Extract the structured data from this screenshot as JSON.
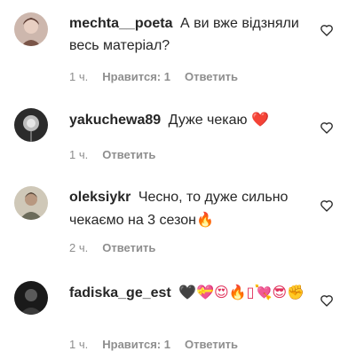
{
  "comments": [
    {
      "username": "mechta__poeta",
      "text": "А ви вже відзняли весь матеріал?",
      "time": "1 ч.",
      "likes": "Нравится: 1",
      "reply": "Ответить",
      "avatar_icon": "woman-portrait-avatar"
    },
    {
      "username": "yakuchewa89",
      "text": "Дуже чекаю",
      "emoji": "❤️",
      "time": "1 ч.",
      "reply": "Ответить",
      "avatar_icon": "dandelion-avatar"
    },
    {
      "username": "oleksiykr",
      "text": "Чесно, то дуже сильно чекаємо на 3 сезон",
      "emoji": "🔥",
      "time": "2 ч.",
      "reply": "Ответить",
      "avatar_icon": "man-portrait-avatar"
    },
    {
      "username": "fadiska_ge_est",
      "text": "",
      "emoji": "🖤💝😍🔥▯💘😎✊",
      "time": "1 ч.",
      "likes": "Нравится: 1",
      "reply": "Ответить",
      "avatar_icon": "dark-portrait-avatar"
    }
  ],
  "colors": {
    "text": "#262626",
    "meta": "#8e8e8e",
    "background": "#ffffff"
  }
}
